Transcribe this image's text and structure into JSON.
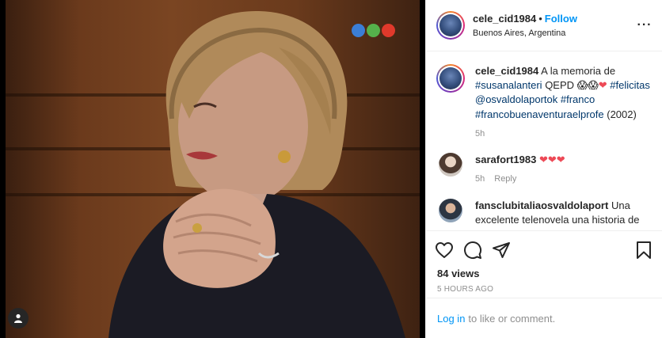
{
  "colors": {
    "accent": "#0095f6",
    "heart": "#ed4956",
    "tag": "#00376b",
    "muted": "#8e8e8e"
  },
  "media": {
    "channel_logo_colors": [
      "#3b7ed6",
      "#55b14b",
      "#e0392b"
    ],
    "audio_icon": "person-icon"
  },
  "header": {
    "username": "cele_cid1984",
    "separator": "•",
    "follow_label": "Follow",
    "location": "Buenos Aires, Argentina",
    "more_icon": "ellipsis-icon"
  },
  "caption": {
    "username": "cele_cid1984",
    "text_intro": "A la memoria de",
    "tag1": "#susanalanteri",
    "text_qepd": "QEPD",
    "emoji": "😱😱",
    "heart": "❤",
    "tag2": "#felicitas",
    "tag3": "@osvaldolaportok",
    "tag4": "#franco",
    "tag5": "#francobuenaventuraelprofe",
    "year": "(2002)",
    "age": "5h"
  },
  "comments": [
    {
      "username": "sarafort1983",
      "text": "❤❤❤",
      "age": "5h",
      "reply_label": "Reply"
    },
    {
      "username": "fansclubitaliaosvaldolaport",
      "text": "Una excelente telenovela una historia de"
    }
  ],
  "actions": {
    "like_icon": "heart-icon",
    "comment_icon": "comment-icon",
    "share_icon": "send-icon",
    "save_icon": "bookmark-icon",
    "views": "84 views",
    "timestamp": "5 HOURS AGO"
  },
  "footer": {
    "login_link": "Log in",
    "login_text": "to like or comment."
  }
}
